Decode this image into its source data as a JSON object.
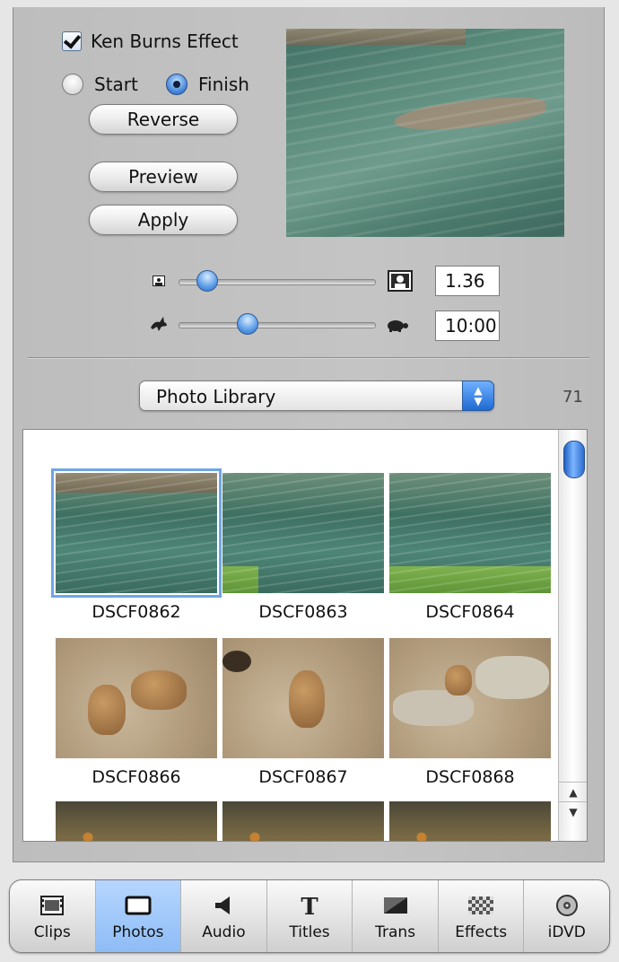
{
  "ken_burns": {
    "label": "Ken Burns Effect",
    "checked": true
  },
  "direction": {
    "start_label": "Start",
    "finish_label": "Finish",
    "selected": "Finish"
  },
  "buttons": {
    "reverse": "Reverse",
    "preview": "Preview",
    "apply": "Apply"
  },
  "zoom": {
    "value": "1.36",
    "slider_fraction": 0.1
  },
  "duration": {
    "value": "10:00",
    "slider_fraction": 0.33
  },
  "source_popup": {
    "selected": "Photo Library"
  },
  "photo_count": "71",
  "photos": [
    {
      "name": "DSCF0862",
      "selected": true
    },
    {
      "name": "DSCF0863",
      "selected": false
    },
    {
      "name": "DSCF0864",
      "selected": false
    },
    {
      "name": "DSCF0866",
      "selected": false
    },
    {
      "name": "DSCF0867",
      "selected": false
    },
    {
      "name": "DSCF0868",
      "selected": false
    }
  ],
  "toolbar": {
    "items": [
      {
        "label": "Clips",
        "icon": "clips-icon",
        "active": false
      },
      {
        "label": "Photos",
        "icon": "photos-icon",
        "active": true
      },
      {
        "label": "Audio",
        "icon": "audio-icon",
        "active": false
      },
      {
        "label": "Titles",
        "icon": "titles-icon",
        "active": false
      },
      {
        "label": "Trans",
        "icon": "transitions-icon",
        "active": false
      },
      {
        "label": "Effects",
        "icon": "effects-icon",
        "active": false
      },
      {
        "label": "iDVD",
        "icon": "idvd-icon",
        "active": false
      }
    ]
  },
  "colors": {
    "accent": "#3c7fd6",
    "selection": "#6fa5e6",
    "active_tab": "#a9ccfb"
  }
}
